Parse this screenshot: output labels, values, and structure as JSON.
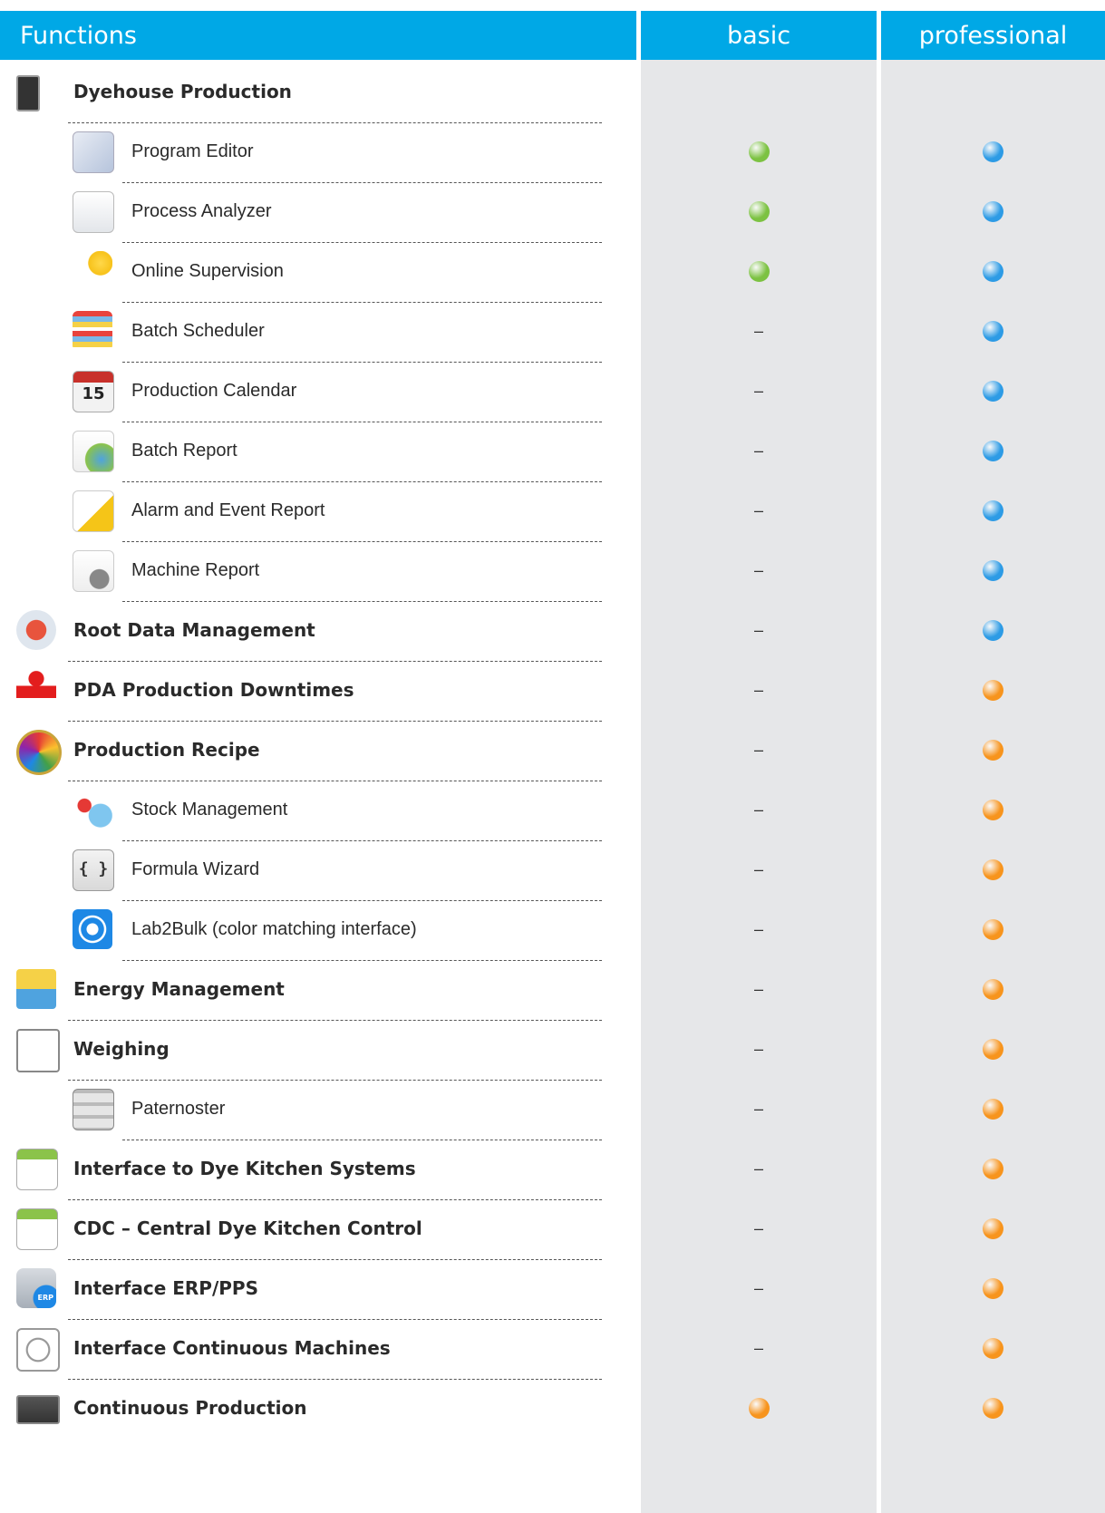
{
  "header": {
    "functions": "Functions",
    "basic": "basic",
    "professional": "professional"
  },
  "colors": {
    "header": "#00a8e6",
    "green": "#7cc242",
    "blue": "#2d9be5",
    "orange": "#f7941d",
    "column_bg": "#e6e7e9"
  },
  "dash": "–",
  "rows": [
    {
      "label": "Dyehouse Production",
      "level": "main",
      "icon": "touch-panel-icon",
      "basic": "none",
      "pro": "none"
    },
    {
      "label": "Program Editor",
      "level": "sub",
      "icon": "program-editor-icon",
      "basic": "green",
      "pro": "blue"
    },
    {
      "label": "Process Analyzer",
      "level": "sub",
      "icon": "process-analyzer-icon",
      "basic": "green",
      "pro": "blue"
    },
    {
      "label": "Online Supervision",
      "level": "sub",
      "icon": "online-supervision-icon",
      "basic": "green",
      "pro": "blue"
    },
    {
      "label": "Batch Scheduler",
      "level": "sub",
      "icon": "batch-scheduler-icon",
      "basic": "dash",
      "pro": "blue"
    },
    {
      "label": "Production Calendar",
      "level": "sub",
      "icon": "calendar-icon",
      "basic": "dash",
      "pro": "blue"
    },
    {
      "label": "Batch Report",
      "level": "sub",
      "icon": "batch-report-icon",
      "basic": "dash",
      "pro": "blue"
    },
    {
      "label": "Alarm and Event Report",
      "level": "sub",
      "icon": "alarm-report-icon",
      "basic": "dash",
      "pro": "blue"
    },
    {
      "label": "Machine Report",
      "level": "sub",
      "icon": "machine-report-icon",
      "basic": "dash",
      "pro": "blue"
    },
    {
      "label": "Root Data Management",
      "level": "main",
      "icon": "root-data-icon",
      "basic": "dash",
      "pro": "blue"
    },
    {
      "label": "PDA Production Downtimes",
      "level": "main",
      "icon": "person-icon",
      "basic": "dash",
      "pro": "orange"
    },
    {
      "label": "Production Recipe",
      "level": "main",
      "icon": "color-wheel-icon",
      "basic": "dash",
      "pro": "orange"
    },
    {
      "label": "Stock Management",
      "level": "sub",
      "icon": "stock-management-icon",
      "basic": "dash",
      "pro": "orange"
    },
    {
      "label": "Formula Wizard",
      "level": "sub",
      "icon": "formula-wizard-icon",
      "basic": "dash",
      "pro": "orange"
    },
    {
      "label": "Lab2Bulk (color matching interface)",
      "level": "sub",
      "icon": "target-icon",
      "basic": "dash",
      "pro": "orange"
    },
    {
      "label": "Energy Management",
      "level": "main",
      "icon": "energy-icon",
      "basic": "dash",
      "pro": "orange"
    },
    {
      "label": "Weighing",
      "level": "main",
      "icon": "scale-icon",
      "basic": "dash",
      "pro": "orange"
    },
    {
      "label": "Paternoster",
      "level": "sub",
      "icon": "paternoster-icon",
      "basic": "dash",
      "pro": "orange"
    },
    {
      "label": "Interface to Dye Kitchen Systems",
      "level": "main",
      "icon": "dye-kitchen-icon",
      "basic": "dash",
      "pro": "orange"
    },
    {
      "label": "CDC – Central Dye Kitchen Control",
      "level": "main",
      "icon": "central-dye-kitchen-icon",
      "basic": "dash",
      "pro": "orange"
    },
    {
      "label": "Interface ERP/PPS",
      "level": "main",
      "icon": "erp-database-icon",
      "basic": "dash",
      "pro": "orange"
    },
    {
      "label": "Interface Continuous Machines",
      "level": "main",
      "icon": "continuous-machine-icon",
      "basic": "dash",
      "pro": "orange"
    },
    {
      "label": "Continuous Production",
      "level": "main",
      "icon": "continuous-production-icon",
      "basic": "orange",
      "pro": "orange"
    }
  ]
}
